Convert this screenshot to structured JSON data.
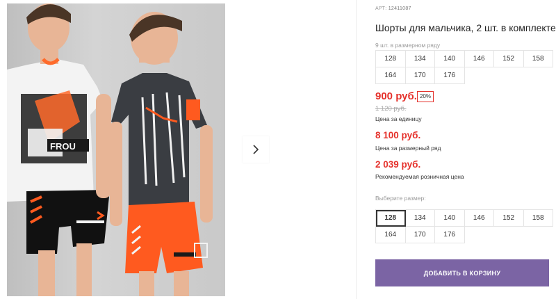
{
  "product": {
    "article_label": "АРТ:",
    "article_value": "12411087",
    "title": "Шорты для мальчика, 2 шт. в комплекте"
  },
  "size_row": {
    "label": "9 шт. в размерном ряду",
    "sizes": [
      "128",
      "134",
      "140",
      "146",
      "152",
      "158",
      "164",
      "170",
      "176"
    ]
  },
  "pricing": {
    "unit_price": "900 руб.",
    "discount_badge": "20%",
    "old_price": "1 120 руб.",
    "unit_label": "Цена за единицу",
    "row_price": "8 100 руб.",
    "row_label": "Цена за размерный ряд",
    "retail_price": "2 039 руб.",
    "retail_label": "Рекомендуемая розничная цена"
  },
  "size_select": {
    "label": "Выберите размер:",
    "sizes": [
      "128",
      "134",
      "140",
      "146",
      "152",
      "158",
      "164",
      "170",
      "176"
    ],
    "selected": "128"
  },
  "cart": {
    "button_label": "ДОБАВИТЬ В КОРЗИНУ"
  },
  "gallery": {
    "next_icon": "chevron-right-icon"
  },
  "colors": {
    "accent_purple": "#7b64a4",
    "price_red": "#e5322c",
    "shorts_orange": "#ff5a1f",
    "tshirt_dark": "#3a3d42"
  }
}
